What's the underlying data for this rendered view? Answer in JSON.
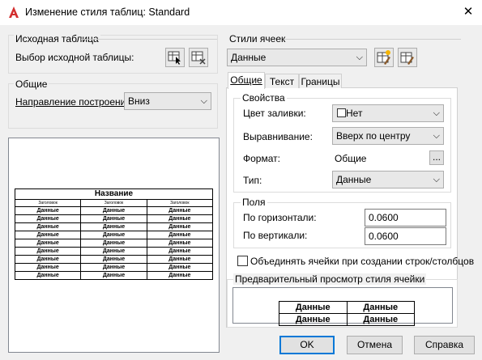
{
  "window": {
    "title": "Изменение стиля таблиц: Standard",
    "close_label": "✕"
  },
  "source": {
    "group_title": "Исходная таблица",
    "select_label": "Выбор исходной таблицы:"
  },
  "general": {
    "group_title": "Общие",
    "direction_label": "Направление построения:",
    "direction_value": "Вниз"
  },
  "preview_table": {
    "title": "Название",
    "headers": [
      "Заголовок",
      "Заголовок",
      "Заголовок"
    ],
    "cell": "Данные",
    "rows": 9
  },
  "cell_styles": {
    "group_title": "Стили ячеек",
    "selected": "Данные"
  },
  "tabs": [
    "Общие",
    "Текст",
    "Границы"
  ],
  "properties": {
    "group_title": "Свойства",
    "fill_label": "Цвет заливки:",
    "fill_value": "Нет",
    "align_label": "Выравнивание:",
    "align_value": "Вверх по центру",
    "format_label": "Формат:",
    "format_value": "Общие",
    "format_button": "...",
    "type_label": "Тип:",
    "type_value": "Данные"
  },
  "margins": {
    "group_title": "Поля",
    "horizontal_label": "По горизонтали:",
    "horizontal_value": "0.0600",
    "vertical_label": "По вертикали:",
    "vertical_value": "0.0600"
  },
  "merge_label": "Объединять ячейки при создании строк/столбцов",
  "cell_preview": {
    "group_title": "Предварительный просмотр стиля ячейки",
    "cells": [
      [
        "Данные",
        "Данные"
      ],
      [
        "Данные",
        "Данные"
      ]
    ]
  },
  "buttons": {
    "ok": "OK",
    "cancel": "Отмена",
    "help": "Справка"
  },
  "colors": {
    "accent": "#0078d7",
    "autocad_red": "#d32f2f"
  }
}
